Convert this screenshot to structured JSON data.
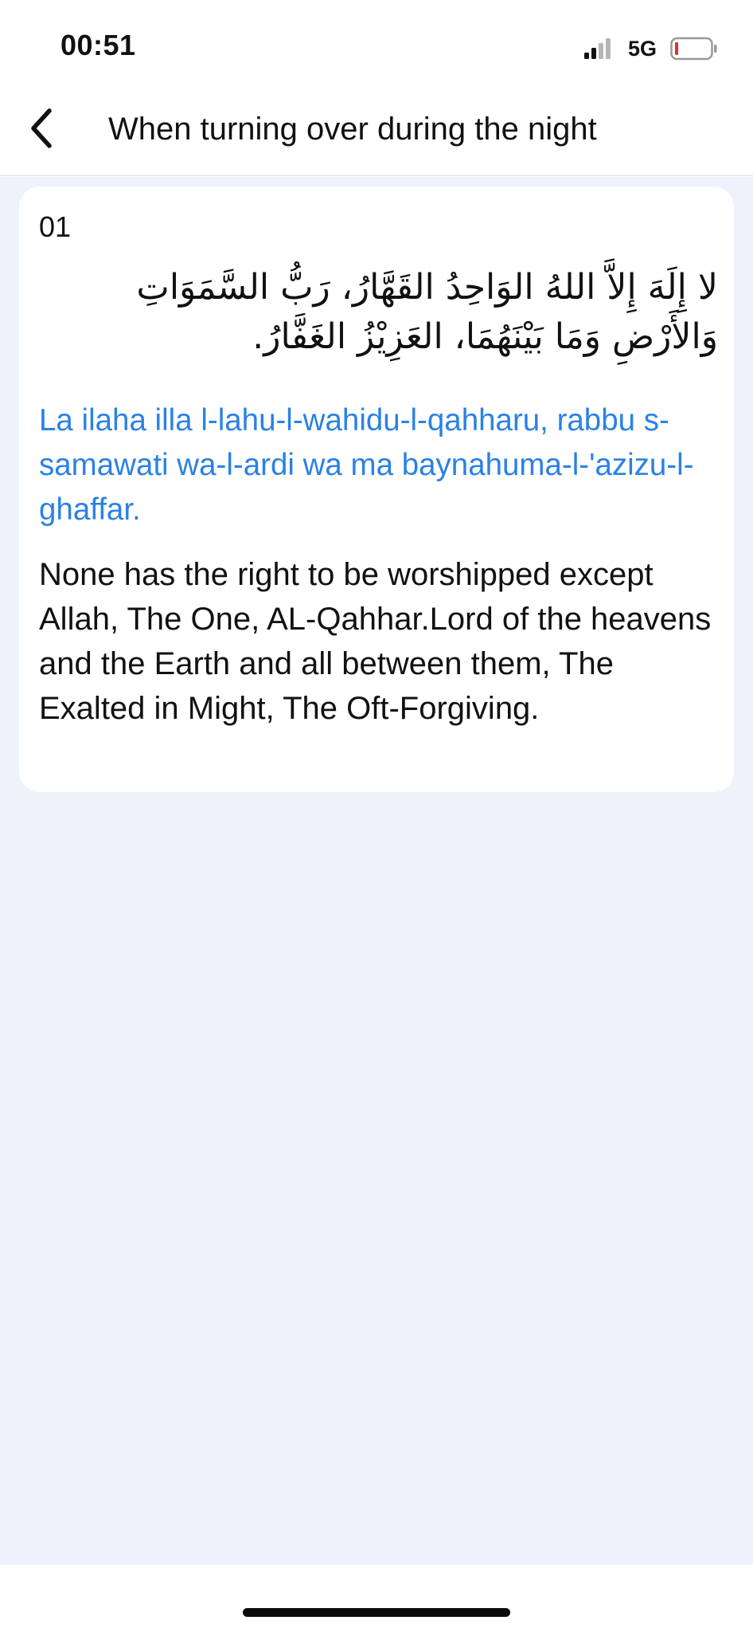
{
  "status_bar": {
    "time": "00:51",
    "network": "5G",
    "signal_icon": "signal-bars-icon",
    "battery_icon": "battery-low-icon",
    "battery_color": "#e0312b"
  },
  "nav": {
    "back_icon": "chevron-left-icon",
    "title": "When turning over during the night"
  },
  "colors": {
    "accent": "#2a81e6",
    "content_background": "#eef3fb",
    "card_background": "#ffffff"
  },
  "items": [
    {
      "number": "01",
      "arabic": "لا إِلَهَ إِلاَّ اللهُ الوَاحِدُ القَهَّارُ، رَبُّ السَّمَوَاتِ وَالأَرْضِ وَمَا بَيْنَهُمَا، العَزِيْزُ الغَفَّارُ.",
      "transliteration": "La ilaha illa l-lahu-l-wahidu-l-qahharu, rabbu s-samawati wa-l-ardi wa ma baynahuma-l-'azizu-l-ghaffar.",
      "translation": "None has the right to be worshipped except Allah, The One, AL-Qahhar.Lord of the heavens and the Earth and all between them, The Exalted in Might, The Oft-Forgiving."
    }
  ]
}
